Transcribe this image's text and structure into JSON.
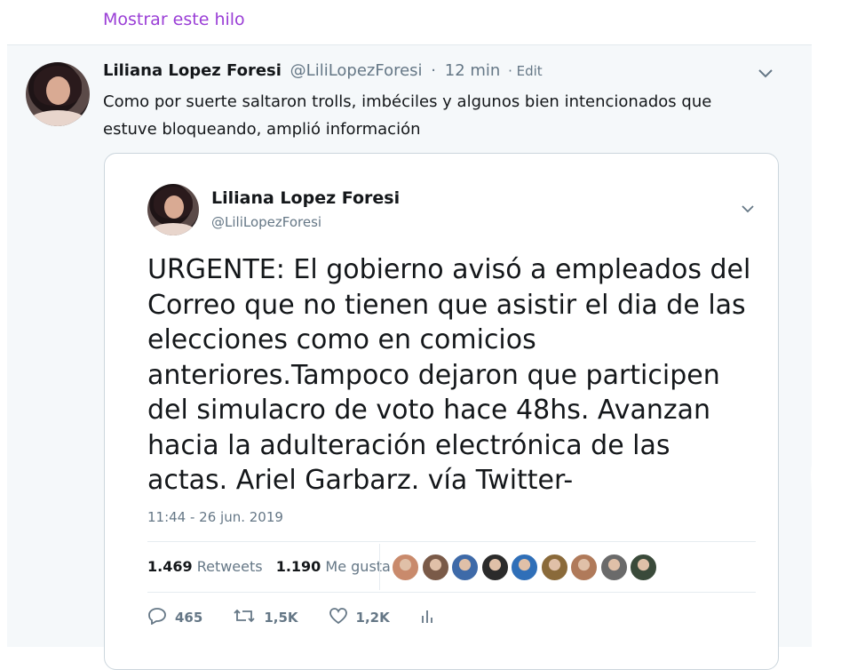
{
  "thread": {
    "show_thread_label": "Mostrar este hilo"
  },
  "tweet": {
    "author_name": "Liliana Lopez Foresi",
    "author_handle": "@LiliLopezForesi",
    "separator": "·",
    "time": "12 min",
    "edit_label": "· Edit",
    "text": "Como por suerte saltaron trolls, imbéciles y algunos bien intencionados que estuve bloqueando, amplió información"
  },
  "quoted": {
    "author_name": "Liliana Lopez Foresi",
    "author_handle": "@LiliLopezForesi",
    "text": "URGENTE: El gobierno avisó a empleados del Correo que no tienen que asistir el dia de las elecciones como en comicios anteriores.Tampoco dejaron que participen del simulacro de voto hace 48hs. Avanzan hacia la adulteración electrónica de las actas. Ariel Garbarz. vía Twitter-",
    "timestamp": "11:44 - 26 jun. 2019",
    "retweets_count": "1.469",
    "retweets_label": "Retweets",
    "likes_count": "1.190",
    "likes_label": "Me gusta",
    "liker_avatars": [
      {
        "name": "liker-1",
        "color": "#c98a6c"
      },
      {
        "name": "liker-2",
        "color": "#7a5a48"
      },
      {
        "name": "liker-3",
        "color": "#3e6aa8"
      },
      {
        "name": "liker-4",
        "color": "#2b2b2b"
      },
      {
        "name": "liker-5",
        "color": "#2f6fb8"
      },
      {
        "name": "liker-6",
        "color": "#8a6a3a"
      },
      {
        "name": "liker-7",
        "color": "#b07a5a"
      },
      {
        "name": "liker-8",
        "color": "#6a6a6a"
      },
      {
        "name": "liker-9",
        "color": "#3a4a3a"
      }
    ],
    "reply_count": "465",
    "retweet_count_short": "1,5K",
    "like_count_short": "1,2K"
  },
  "colors": {
    "link_purple": "#9a3ed6",
    "secondary_text": "#657786",
    "border": "#ccd6dd"
  },
  "icons": [
    "chevron-down-icon",
    "reply-icon",
    "retweet-icon",
    "heart-icon",
    "analytics-icon"
  ]
}
